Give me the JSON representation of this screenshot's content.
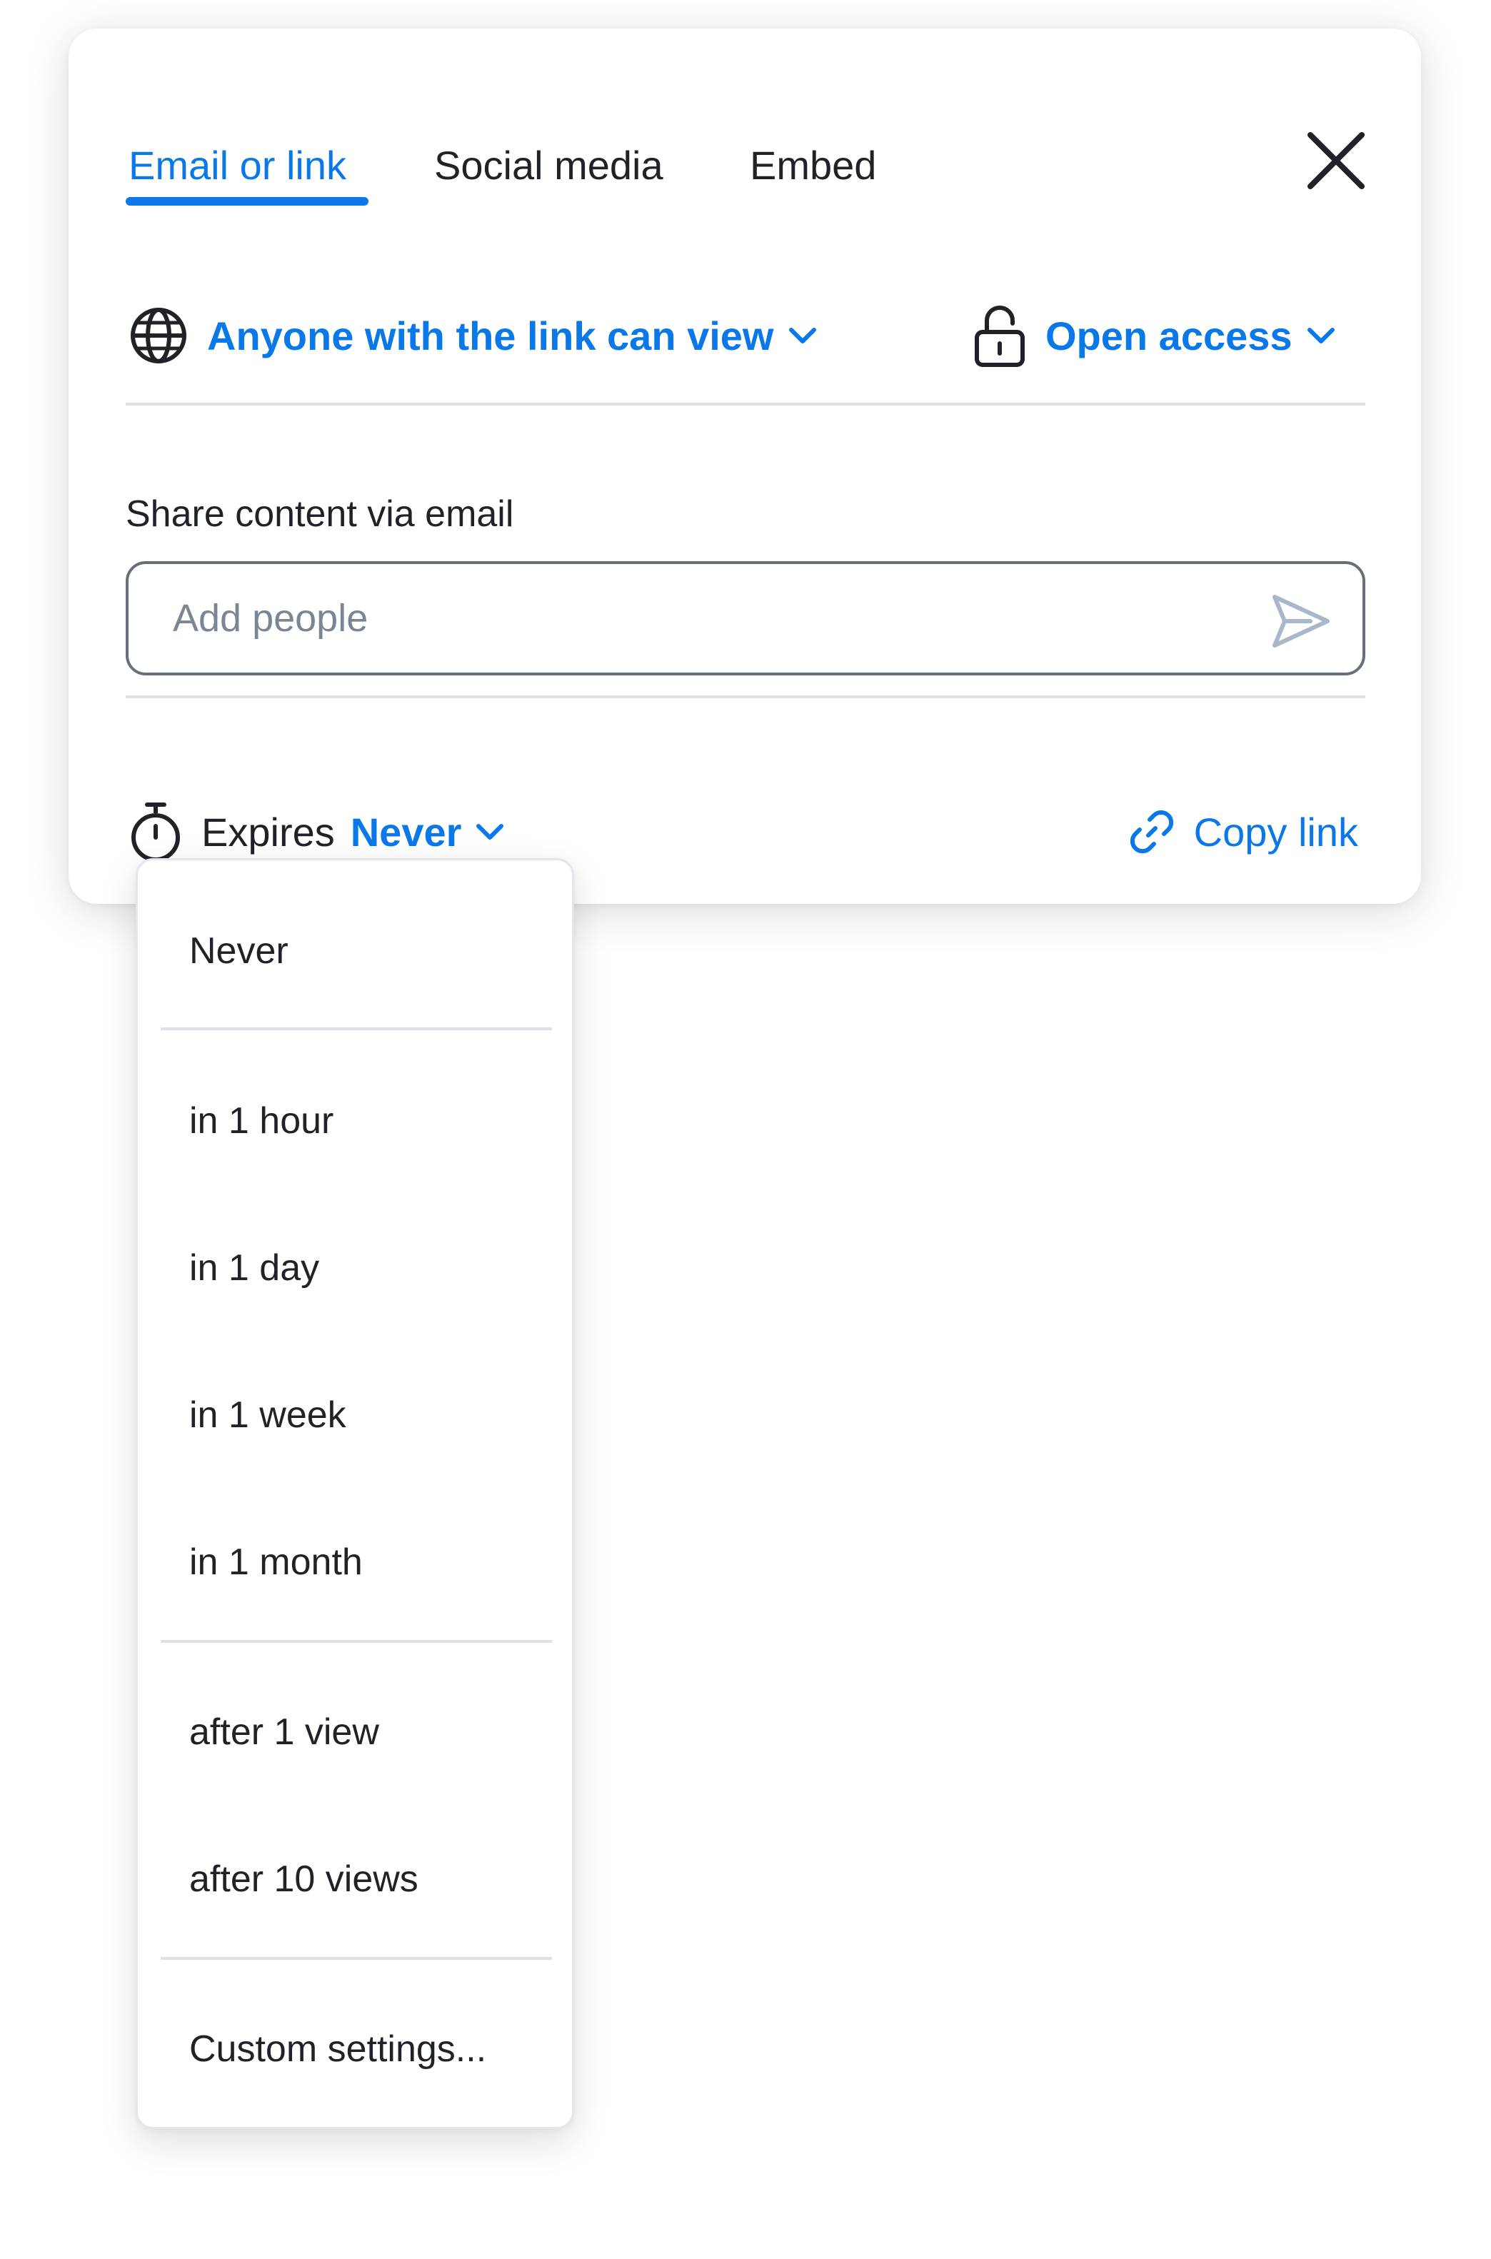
{
  "tabs": [
    {
      "label": "Email or link",
      "active": true
    },
    {
      "label": "Social media",
      "active": false
    },
    {
      "label": "Embed",
      "active": false
    }
  ],
  "access": {
    "visibility_label": "Anyone with the link can view",
    "visibility_icon": "globe-icon",
    "access_label": "Open access",
    "access_icon": "unlocked-padlock-icon"
  },
  "email_share": {
    "section_label": "Share content via email",
    "input_value": "",
    "input_placeholder": "Add people",
    "send_icon": "send-icon"
  },
  "expires": {
    "label": "Expires",
    "value": "Never",
    "icon": "stopwatch-icon"
  },
  "copy_link": {
    "label": "Copy link",
    "icon": "link-icon"
  },
  "expiry_menu": {
    "items": [
      "Never",
      "in 1 hour",
      "in 1 day",
      "in 1 week",
      "in 1 month",
      "after 1 view",
      "after 10 views",
      "Custom settings..."
    ]
  },
  "colors": {
    "accent": "#0a78e8",
    "text": "#1f2328",
    "divider": "#dde1e6",
    "placeholder": "#7a8694"
  }
}
